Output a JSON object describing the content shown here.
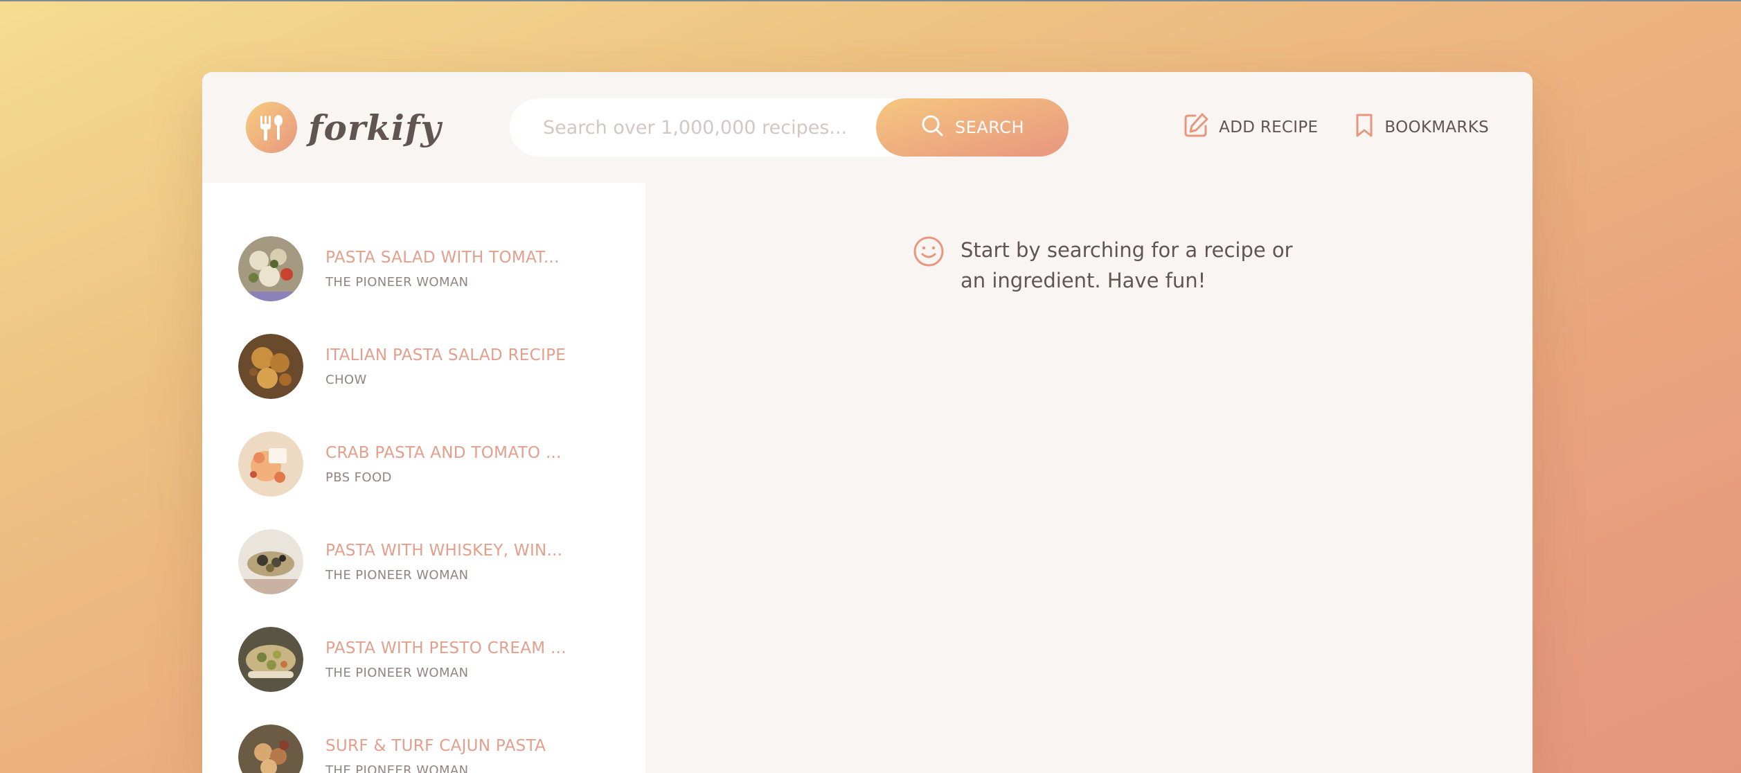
{
  "app": {
    "name": "forkify",
    "colors": {
      "accent": "#e8977f",
      "accent_light": "#f5c77f",
      "title_color": "#e39f8b",
      "text": "#615551"
    }
  },
  "search": {
    "placeholder": "Search over 1,000,000 recipes...",
    "button_label": "SEARCH",
    "icon": "search-icon"
  },
  "nav": {
    "add_recipe": {
      "label": "ADD RECIPE",
      "icon": "edit-icon"
    },
    "bookmarks": {
      "label": "BOOKMARKS",
      "icon": "bookmark-icon"
    }
  },
  "results": [
    {
      "title": "PASTA SALAD WITH TOMAT...",
      "publisher": "THE PIONEER WOMAN"
    },
    {
      "title": "ITALIAN PASTA SALAD RECIPE",
      "publisher": "CHOW"
    },
    {
      "title": "CRAB PASTA AND TOMATO ...",
      "publisher": "PBS FOOD"
    },
    {
      "title": "PASTA WITH WHISKEY, WIN...",
      "publisher": "THE PIONEER WOMAN"
    },
    {
      "title": "PASTA WITH PESTO CREAM ...",
      "publisher": "THE PIONEER WOMAN"
    },
    {
      "title": "SURF & TURF CAJUN PASTA",
      "publisher": "THE PIONEER WOMAN"
    }
  ],
  "message": {
    "icon": "smile-icon",
    "text": "Start by searching for a recipe or an ingredient. Have fun!"
  }
}
